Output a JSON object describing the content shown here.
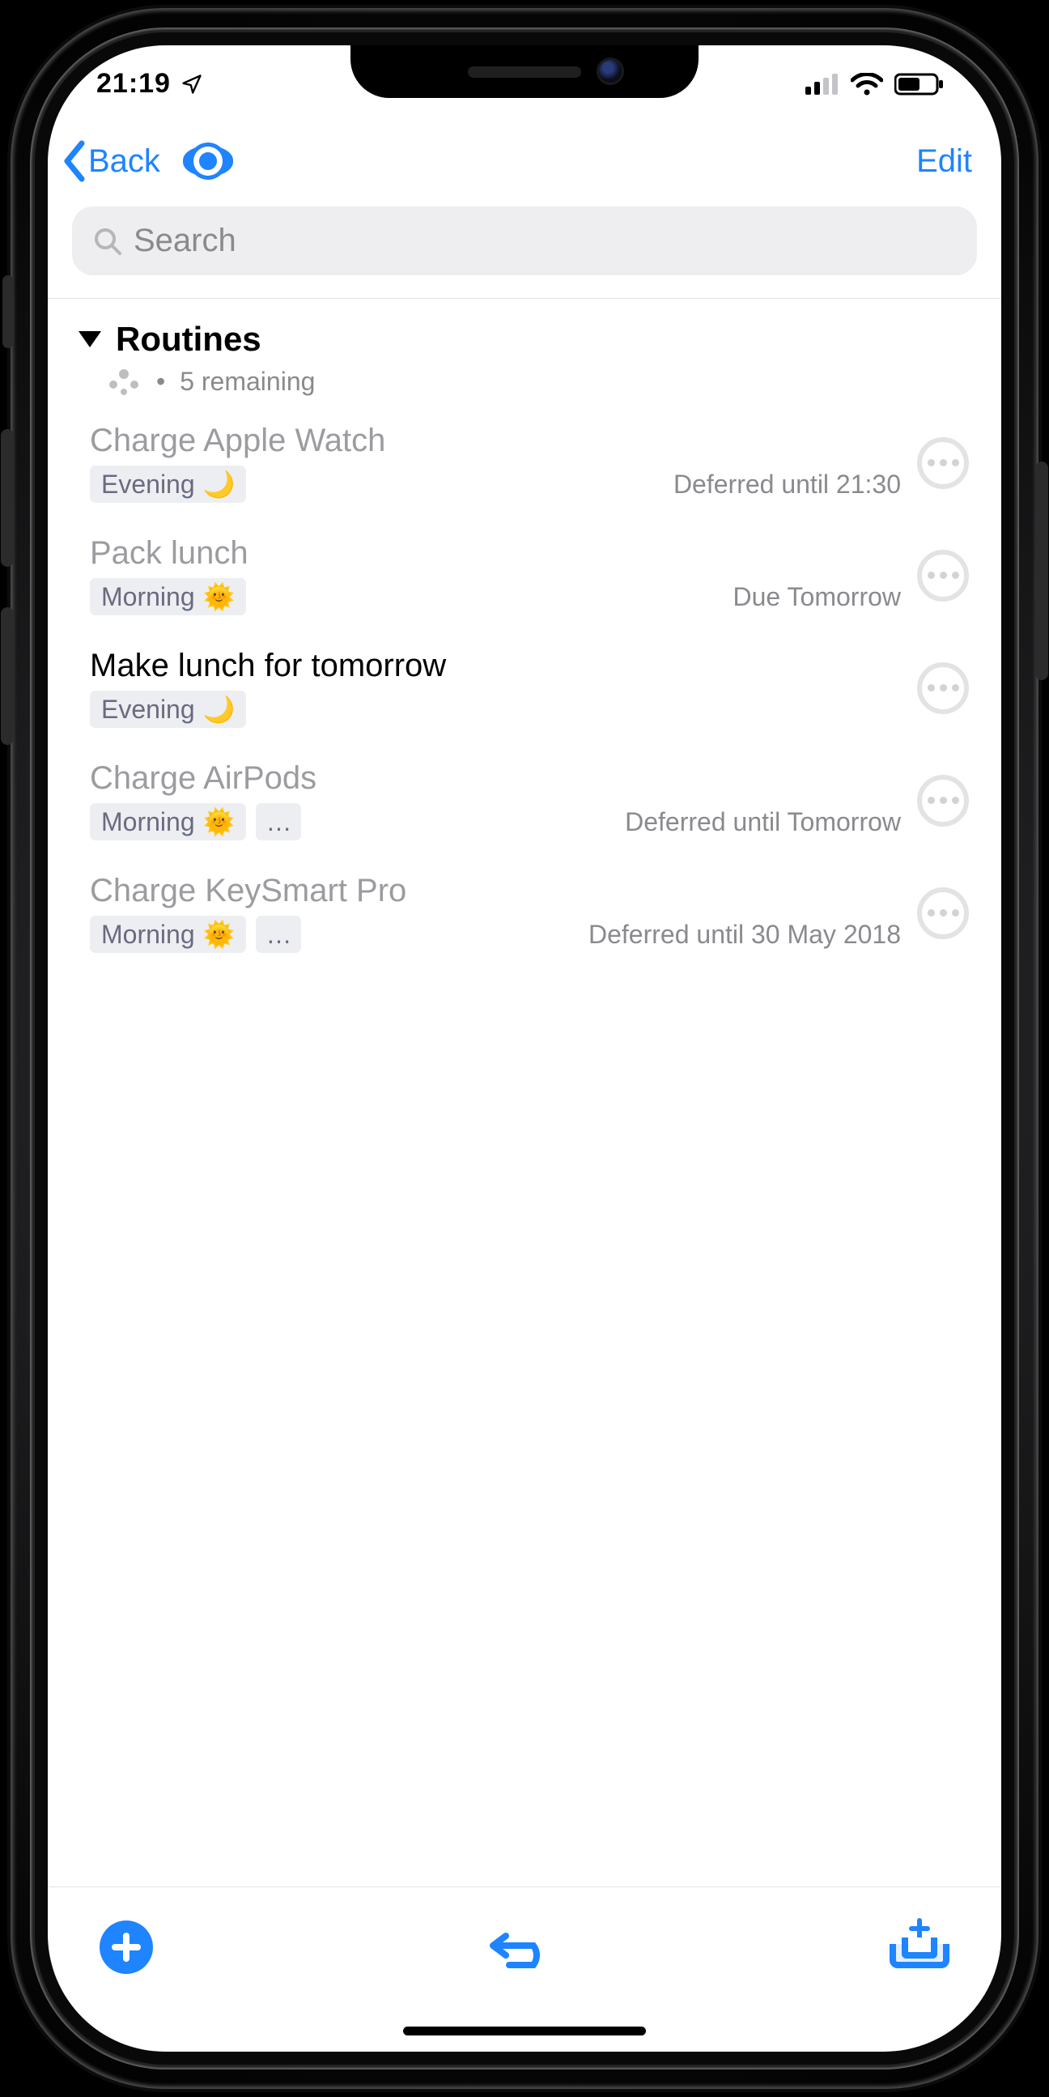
{
  "status": {
    "time": "21:19"
  },
  "nav": {
    "back_label": "Back",
    "edit_label": "Edit"
  },
  "search": {
    "placeholder": "Search"
  },
  "group": {
    "title": "Routines",
    "remaining_text": "5 remaining"
  },
  "tags": {
    "evening_label": "Evening",
    "evening_emoji": "🌙",
    "morning_label": "Morning",
    "morning_emoji": "🌞",
    "ellipsis": "…"
  },
  "tasks": [
    {
      "title": "Charge Apple Watch",
      "active": false,
      "tags": [
        "evening"
      ],
      "extra_chip": false,
      "status": "Deferred until 21:30"
    },
    {
      "title": "Pack lunch",
      "active": false,
      "tags": [
        "morning"
      ],
      "extra_chip": false,
      "status": "Due Tomorrow"
    },
    {
      "title": "Make lunch for tomorrow",
      "active": true,
      "tags": [
        "evening"
      ],
      "extra_chip": false,
      "status": ""
    },
    {
      "title": "Charge AirPods",
      "active": false,
      "tags": [
        "morning"
      ],
      "extra_chip": true,
      "status": "Deferred until Tomorrow"
    },
    {
      "title": "Charge KeySmart Pro",
      "active": false,
      "tags": [
        "morning"
      ],
      "extra_chip": true,
      "status": "Deferred until 30 May 2018"
    }
  ]
}
